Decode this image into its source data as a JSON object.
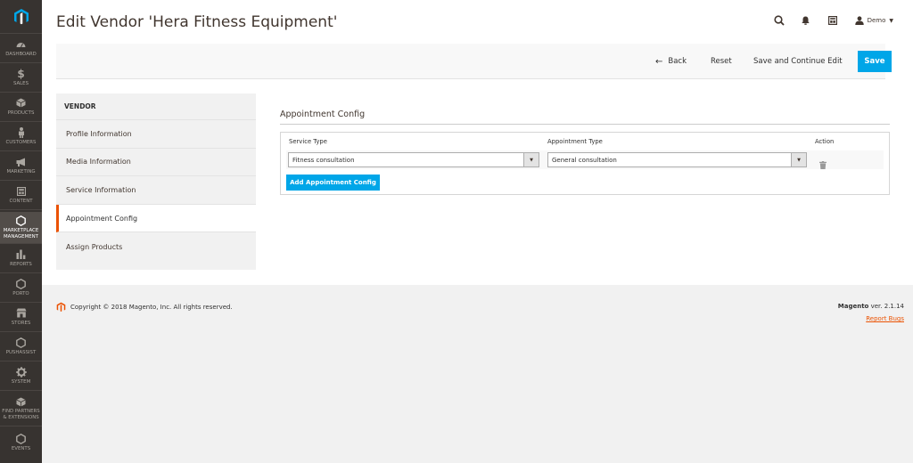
{
  "sidebar": {
    "items": [
      {
        "label": "DASHBOARD",
        "icon": "dashboard-icon"
      },
      {
        "label": "SALES",
        "icon": "dollar-icon"
      },
      {
        "label": "PRODUCTS",
        "icon": "box-icon"
      },
      {
        "label": "CUSTOMERS",
        "icon": "person-icon"
      },
      {
        "label": "MARKETING",
        "icon": "megaphone-icon"
      },
      {
        "label": "CONTENT",
        "icon": "layout-icon"
      },
      {
        "label": "MARKETPLACE",
        "label2": "MANAGEMENT",
        "icon": "hexagon-icon",
        "active": true
      },
      {
        "label": "REPORTS",
        "icon": "bar-chart-icon"
      },
      {
        "label": "PORTO",
        "icon": "hexagon-icon"
      },
      {
        "label": "STORES",
        "icon": "store-icon"
      },
      {
        "label": "PUSHASSIST",
        "icon": "hexagon-icon"
      },
      {
        "label": "SYSTEM",
        "icon": "gear-icon"
      },
      {
        "label": "FIND PARTNERS",
        "label2": "& EXTENSIONS",
        "icon": "cube-icon"
      },
      {
        "label": "EVENTS",
        "icon": "hexagon-icon"
      }
    ]
  },
  "header": {
    "title": "Edit Vendor 'Hera Fitness Equipment'",
    "user_name": "Demo"
  },
  "actions": {
    "back": "Back",
    "reset": "Reset",
    "save_continue": "Save and Continue Edit",
    "save": "Save"
  },
  "tabs": {
    "title": "VENDOR",
    "items": [
      {
        "label": "Profile Information"
      },
      {
        "label": "Media Information"
      },
      {
        "label": "Service Information"
      },
      {
        "label": "Appointment Config",
        "active": true
      },
      {
        "label": "Assign Products"
      }
    ]
  },
  "appointment": {
    "section_title": "Appointment Config",
    "col_service_type": "Service Type",
    "col_appointment_type": "Appointment Type",
    "col_action": "Action",
    "row": {
      "service_type": "Fitness consultation",
      "appointment_type": "General consultation"
    },
    "add_button": "Add Appointment Config"
  },
  "footer": {
    "copyright": "Copyright © 2018 Magento, Inc. All rights reserved.",
    "brand": "Magento",
    "version": " ver. 2.1.14",
    "report_bugs": "Report Bugs"
  },
  "colors": {
    "sidebar_bg": "#373330",
    "accent_blue": "#00a6e8",
    "accent_orange": "#eb5202"
  }
}
